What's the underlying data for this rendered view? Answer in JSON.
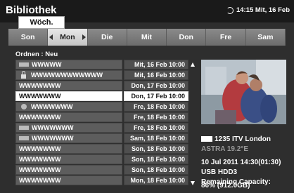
{
  "header": {
    "title": "Bibliothek",
    "clock": "14:15 Mit, 16 Feb"
  },
  "tabs": {
    "week": "Wöch."
  },
  "days": [
    {
      "label": "Son",
      "selected": false,
      "arrow": "none"
    },
    {
      "label": "Mon",
      "selected": true,
      "arrow": "both"
    },
    {
      "label": "Die",
      "selected": false,
      "arrow": "none"
    },
    {
      "label": "Mit",
      "selected": false,
      "arrow": "none"
    },
    {
      "label": "Don",
      "selected": false,
      "arrow": "none"
    },
    {
      "label": "Fre",
      "selected": false,
      "arrow": "none"
    },
    {
      "label": "Sam",
      "selected": false,
      "arrow": "none"
    }
  ],
  "sort": "Ordnen : Neu",
  "recordings": [
    {
      "icon": "rec-icon",
      "name": "WWWWW",
      "date": "Mit, 16 Feb 10:00",
      "selected": false
    },
    {
      "icon": "lock-icon",
      "name": "WWWWWWWWWWWW",
      "date": "Mit, 16 Feb 10:00",
      "selected": false
    },
    {
      "icon": "none",
      "name": "WWWWWWW",
      "date": "Don, 17 Feb 10:00",
      "selected": false
    },
    {
      "icon": "none",
      "name": "WWWWWWW",
      "date": "Don, 17 Feb 10:00",
      "selected": true
    },
    {
      "icon": "dot-icon",
      "name": "WWWWWWW",
      "date": "Fre, 18 Feb 10:00",
      "selected": false
    },
    {
      "icon": "none",
      "name": "WWWWWWW",
      "date": "Fre, 18 Feb 10:00",
      "selected": false
    },
    {
      "icon": "rec-icon",
      "name": "WWWWWWW",
      "date": "Fre, 18 Feb 10:00",
      "selected": false
    },
    {
      "icon": "rec-icon",
      "name": "WWWWWWW",
      "date": "Sam, 18 Feb 10:00",
      "selected": false
    },
    {
      "icon": "none",
      "name": "WWWWWWW",
      "date": "Son, 18 Feb 10:00",
      "selected": false
    },
    {
      "icon": "none",
      "name": "WWWWWWW",
      "date": "Son, 18 Feb 10:00",
      "selected": false
    },
    {
      "icon": "none",
      "name": "WWWWWWW",
      "date": "Son, 18 Feb 10:00",
      "selected": false
    },
    {
      "icon": "none",
      "name": "WWWWWWW",
      "date": "Mon, 18 Feb 10:00",
      "selected": false
    }
  ],
  "details": {
    "channel": "1235 ITV London",
    "satellite": "ASTRA 19.2°E",
    "datetime": "10 Jul 2011  14:30(01:30)",
    "device": "USB HDD3",
    "capacity_label": "Remaining Capacity:",
    "capacity_value": "86% (912.0GB)"
  }
}
